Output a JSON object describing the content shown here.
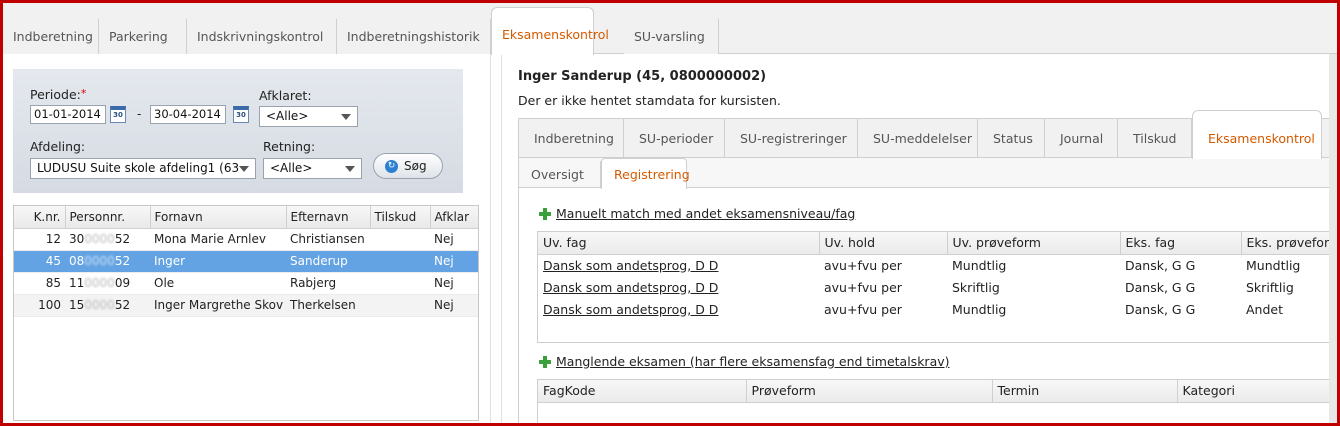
{
  "top_tabs": [
    {
      "label": "Indberetning"
    },
    {
      "label": "Parkering"
    },
    {
      "label": "Indskrivningskontrol"
    },
    {
      "label": "Indberetningshistorik"
    },
    {
      "label": "Eksamenskontrol"
    },
    {
      "label": "SU-varsling"
    }
  ],
  "filters": {
    "periode_label": "Periode:",
    "required_mark": "*",
    "from_date": "01-01-2014",
    "to_date": "30-04-2014",
    "date_separator": "-",
    "cal_text": "30",
    "afklaret_label": "Afklaret:",
    "afklaret_value": "<Alle>",
    "afdeling_label": "Afdeling:",
    "afdeling_value": "LUDUSU Suite skole afdeling1 (63",
    "retning_label": "Retning:",
    "retning_value": "<Alle>",
    "search_button": "Søg",
    "search_icon_glyph": "↻"
  },
  "students_table": {
    "columns": [
      "K.nr.",
      "Personnr.",
      "Fornavn",
      "Efternavn",
      "Tilskud",
      "Afklar"
    ],
    "rows": [
      {
        "knr": "12",
        "pnr_a": "30",
        "pnr_b": "0000",
        "pnr_c": "52",
        "fornavn": "Mona Marie Arnlev",
        "efternavn": "Christiansen",
        "tilskud": "",
        "afklaret": "Nej"
      },
      {
        "knr": "45",
        "pnr_a": "08",
        "pnr_b": "0000",
        "pnr_c": "52",
        "fornavn": "Inger",
        "efternavn": "Sanderup",
        "tilskud": "",
        "afklaret": "Nej"
      },
      {
        "knr": "85",
        "pnr_a": "11",
        "pnr_b": "0000",
        "pnr_c": "09",
        "fornavn": "Ole",
        "efternavn": "Rabjerg",
        "tilskud": "",
        "afklaret": "Nej"
      },
      {
        "knr": "100",
        "pnr_a": "15",
        "pnr_b": "0000",
        "pnr_c": "52",
        "fornavn": "Inger Margrethe Skov",
        "efternavn": "Therkelsen",
        "tilskud": "",
        "afklaret": "Nej"
      }
    ]
  },
  "person": {
    "title": "Inger Sanderup (45, 0800000002)",
    "note": "Der er ikke hentet stamdata for kursisten."
  },
  "inner_tabs": [
    {
      "label": "Indberetning"
    },
    {
      "label": "SU-perioder"
    },
    {
      "label": "SU-registreringer"
    },
    {
      "label": "SU-meddelelser"
    },
    {
      "label": "Status"
    },
    {
      "label": "Journal"
    },
    {
      "label": "Tilskud"
    },
    {
      "label": "Eksamenskontrol"
    }
  ],
  "sub_tabs": [
    {
      "label": "Oversigt"
    },
    {
      "label": "Registrering"
    }
  ],
  "manual_match": {
    "link": "Manuelt match med andet eksamensniveau/fag",
    "columns": [
      "Uv. fag",
      "Uv. hold",
      "Uv. prøveform",
      "Eks. fag",
      "Eks. prøveform"
    ],
    "rows": [
      {
        "uv_fag": "Dansk som andetsprog, D D",
        "uv_hold": "avu+fvu per",
        "uv_proeveform": "Mundtlig",
        "eks_fag": "Dansk, G G",
        "eks_proeveform": "Mundtlig"
      },
      {
        "uv_fag": "Dansk som andetsprog, D D",
        "uv_hold": "avu+fvu per",
        "uv_proeveform": "Skriftlig",
        "eks_fag": "Dansk, G G",
        "eks_proeveform": "Skriftlig"
      },
      {
        "uv_fag": "Dansk som andetsprog, D D",
        "uv_hold": "avu+fvu per",
        "uv_proeveform": "Mundtlig",
        "eks_fag": "Dansk, G G",
        "eks_proeveform": "Andet"
      }
    ]
  },
  "missing_exam": {
    "link": "Manglende eksamen (har flere eksamensfag end timetalskrav)",
    "columns": [
      "FagKode",
      "Prøveform",
      "Termin",
      "Kategori"
    ]
  },
  "colors": {
    "active_tab_text": "#d45a00",
    "selected_row": "#64a3e3",
    "frame": "#c00000",
    "plus_icon": "#3aa13a"
  }
}
